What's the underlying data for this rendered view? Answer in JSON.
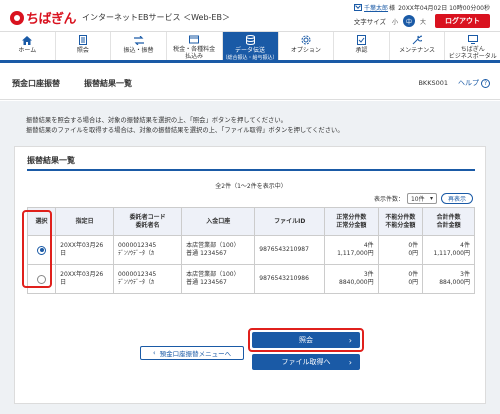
{
  "header": {
    "logo_text": "ちばぎん",
    "service_name": "インターネットEBサービス ＜Web-EB＞",
    "user_name": "千葉太郎",
    "user_suffix": "様",
    "last_login": "20XX年04月02日 10時00分00秒",
    "font_size_label": "文字サイズ",
    "font_sizes": [
      "小",
      "中",
      "大"
    ],
    "logout_label": "ログアウト"
  },
  "nav": {
    "items": [
      {
        "label": "ホーム",
        "icon": "home-icon"
      },
      {
        "label": "照会",
        "icon": "inquiry-icon"
      },
      {
        "label": "振込・振替",
        "icon": "transfer-icon"
      },
      {
        "label": "税金・各種料金",
        "label2": "払込み",
        "icon": "tax-icon"
      },
      {
        "label": "データ伝送",
        "label2": "（総合振込・給与振込）",
        "icon": "data-transmission-icon"
      },
      {
        "label": "オプション",
        "icon": "option-icon"
      },
      {
        "label": "承認",
        "icon": "approval-icon"
      },
      {
        "label": "メンテナンス",
        "icon": "maintenance-icon"
      },
      {
        "label": "ちばぎん",
        "label2": "ビジネスポータル",
        "icon": "portal-icon"
      }
    ]
  },
  "title": {
    "main": "預金口座振替",
    "sub": "振替結果一覧",
    "screen_id": "BKKS001",
    "help_label": "ヘルプ"
  },
  "instructions": [
    "振替結果を照会する場合は、対象の振替結果を選択の上、「照会」ボタンを押してください。",
    "振替結果のファイルを取得する場合は、対象の振替結果を選択の上、「ファイル取得」ボタンを押してください。"
  ],
  "panel": {
    "title": "振替結果一覧",
    "count_text": "全2件（1～2件を表示中）",
    "per_page_label": "表示件数：",
    "per_page_value": "10件",
    "redisplay_label": "再表示",
    "columns": [
      "選択",
      "指定日",
      "委託者コード",
      "委託者名",
      "入金口座",
      "ファイルID",
      "正常分件数",
      "正常分金額",
      "不能分件数",
      "不能分金額",
      "合計件数",
      "合計金額"
    ],
    "rows": [
      {
        "selected": true,
        "date": "20XX年03月26日",
        "code": "0000012345",
        "name": "ﾃﾞﾝｿｳﾃﾞｰﾀ（ｶ",
        "branch": "本店営業部（100）",
        "account": "普通 1234567",
        "file_id": "9876543210987",
        "ok_count": "4件",
        "ok_amount": "1,117,000円",
        "ng_count": "0件",
        "ng_amount": "0円",
        "total_count": "4件",
        "total_amount": "1,117,000円"
      },
      {
        "selected": false,
        "date": "20XX年03月26日",
        "code": "0000012345",
        "name": "ﾃﾞﾝｿｳﾃﾞｰﾀ（ｶ",
        "branch": "本店営業部（100）",
        "account": "普通 1234567",
        "file_id": "9876543210986",
        "ok_count": "3件",
        "ok_amount": "8840,000円",
        "ng_count": "0件",
        "ng_amount": "0円",
        "total_count": "3件",
        "total_amount": "884,000円"
      }
    ]
  },
  "buttons": {
    "back_label": "預金口座振替メニューへ",
    "inquiry_label": "照会",
    "file_label": "ファイル取得へ"
  },
  "colors": {
    "brand_red": "#d9121f",
    "accent_blue": "#1a5aa6",
    "highlight_red": "#e0201c"
  }
}
